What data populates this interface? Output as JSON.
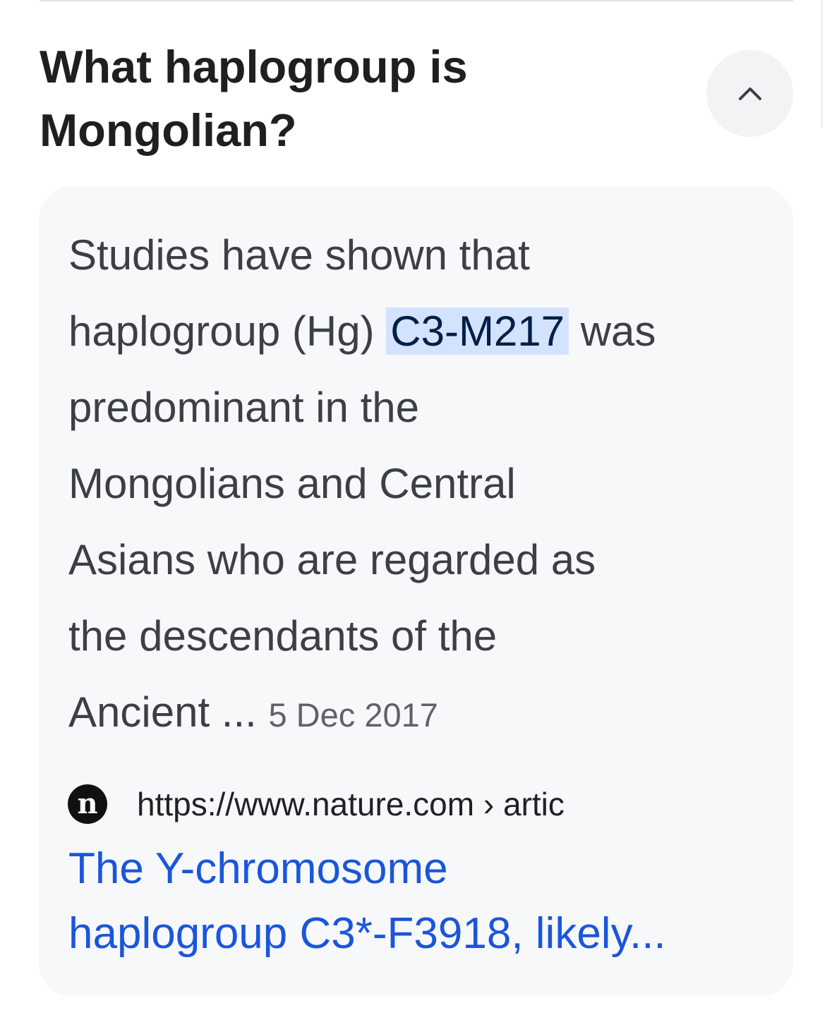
{
  "question": {
    "line1": "What haplogroup is",
    "line2": "Mongolian?"
  },
  "toggle": {
    "icon": "chevron-up-icon",
    "state": "expanded"
  },
  "answer": {
    "lines": {
      "l1": "Studies have shown that",
      "l2_before": "haplogroup (Hg) ",
      "l2_highlight": "C3-M217",
      "l2_after": " was",
      "l3": "predominant in the",
      "l4": "Mongolians and Central",
      "l5": "Asians who are regarded as",
      "l6": "the descendants of the",
      "l7": "Ancient ... "
    },
    "date": "5 Dec 2017"
  },
  "source": {
    "favicon_letter": "n",
    "url": "https://www.nature.com › artic"
  },
  "result": {
    "title_line1": "The Y-chromosome",
    "title_line2": "haplogroup C3*-F3918, likely..."
  },
  "colors": {
    "link": "#1a56db",
    "highlight_bg": "#d3e3fd",
    "card_bg": "#f7f8fa"
  }
}
